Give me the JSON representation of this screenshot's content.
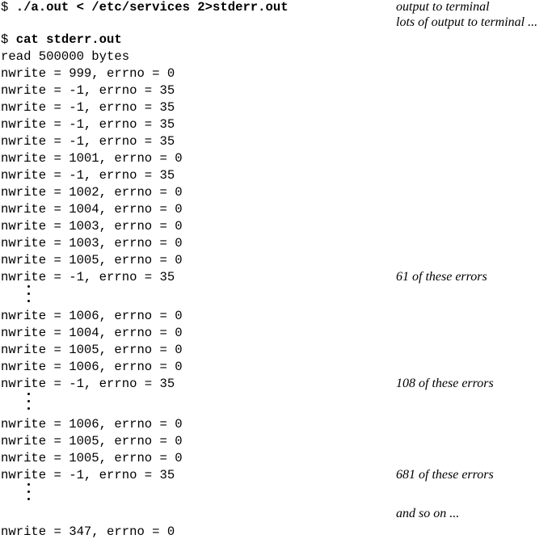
{
  "prompt_symbol": "$",
  "command_1": "./a.out < /etc/services 2>stderr.out",
  "command_1_note": "output to terminal",
  "command_1_note_2": "lots of output to terminal ...",
  "command_2": "cat stderr.out",
  "output": {
    "read_line": "read 500000 bytes",
    "block_1": [
      "nwrite = 999, errno = 0",
      "nwrite = -1, errno = 35",
      "nwrite = -1, errno = 35",
      "nwrite = -1, errno = 35",
      "nwrite = -1, errno = 35",
      "nwrite = 1001, errno = 0",
      "nwrite = -1, errno = 35",
      "nwrite = 1002, errno = 0",
      "nwrite = 1004, errno = 0",
      "nwrite = 1003, errno = 0",
      "nwrite = 1003, errno = 0",
      "nwrite = 1005, errno = 0"
    ],
    "error_line_1": "nwrite = -1, errno = 35",
    "error_note_1": "61 of these errors",
    "block_2": [
      "nwrite = 1006, errno = 0",
      "nwrite = 1004, errno = 0",
      "nwrite = 1005, errno = 0",
      "nwrite = 1006, errno = 0"
    ],
    "error_line_2": "nwrite = -1, errno = 35",
    "error_note_2": "108 of these errors",
    "block_3": [
      "nwrite = 1006, errno = 0",
      "nwrite = 1005, errno = 0",
      "nwrite = 1005, errno = 0"
    ],
    "error_line_3": "nwrite = -1, errno = 35",
    "error_note_3": "681 of these errors",
    "and_so_on_note": "and so on ...",
    "final_line": "nwrite = 347, errno = 0"
  }
}
